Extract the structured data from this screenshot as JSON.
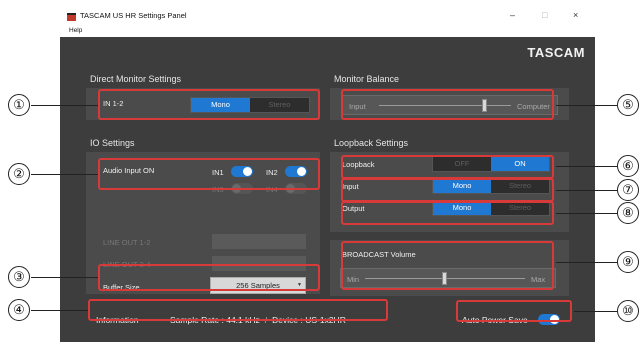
{
  "window": {
    "title": "TASCAM US HR Settings Panel",
    "menu_help": "Help",
    "brand": "TASCAM",
    "controls": {
      "minimize": "–",
      "maximize": "□",
      "close": "×"
    }
  },
  "direct_monitor": {
    "title": "Direct Monitor Settings",
    "input_label": "IN 1-2",
    "options": [
      "Mono",
      "Stereo"
    ],
    "selected": "Mono"
  },
  "monitor_balance": {
    "title": "Monitor Balance",
    "left_label": "Input",
    "right_label": "Computer",
    "level": 0.8
  },
  "io_settings": {
    "title": "IO Settings",
    "audio_input_on": "Audio Input ON",
    "in1_label": "IN1",
    "in2_label": "IN2",
    "in3_label": "IN3",
    "in4_label": "IN4",
    "in1_on": true,
    "in2_on": true,
    "line_out_12": "LINE OUT 1-2",
    "line_out_34": "LINE OUT 3-4",
    "buffer_size_label": "Buffer Size",
    "buffer_size_value": "256 Samples"
  },
  "loopback": {
    "title": "Loopback Settings",
    "loopback_label": "Loopback",
    "loopback_options": [
      "OFF",
      "ON"
    ],
    "loopback_selected": "ON",
    "input_label": "Input",
    "input_options": [
      "Mono",
      "Stereo"
    ],
    "input_selected": "Mono",
    "output_label": "Output",
    "output_options": [
      "Mono",
      "Stereo"
    ],
    "output_selected": "Mono"
  },
  "broadcast_volume": {
    "label": "BROADCAST Volume",
    "min_label": "Min",
    "max_label": "Max",
    "level": 0.5
  },
  "information": {
    "label": "Information",
    "sample_rate": "Sample Rate : 44.1 kHz",
    "separator": "/",
    "device": "Device : US-1x2HR"
  },
  "auto_power_save": {
    "label": "Auto Power Save",
    "on": true
  },
  "callouts": [
    "①",
    "②",
    "③",
    "④",
    "⑤",
    "⑥",
    "⑦",
    "⑧",
    "⑨",
    "⑩"
  ],
  "colors": {
    "accent": "#1f78d1",
    "highlight": "#d83a3a",
    "panel": "#4b4b4b",
    "window": "#3d3d3d"
  }
}
